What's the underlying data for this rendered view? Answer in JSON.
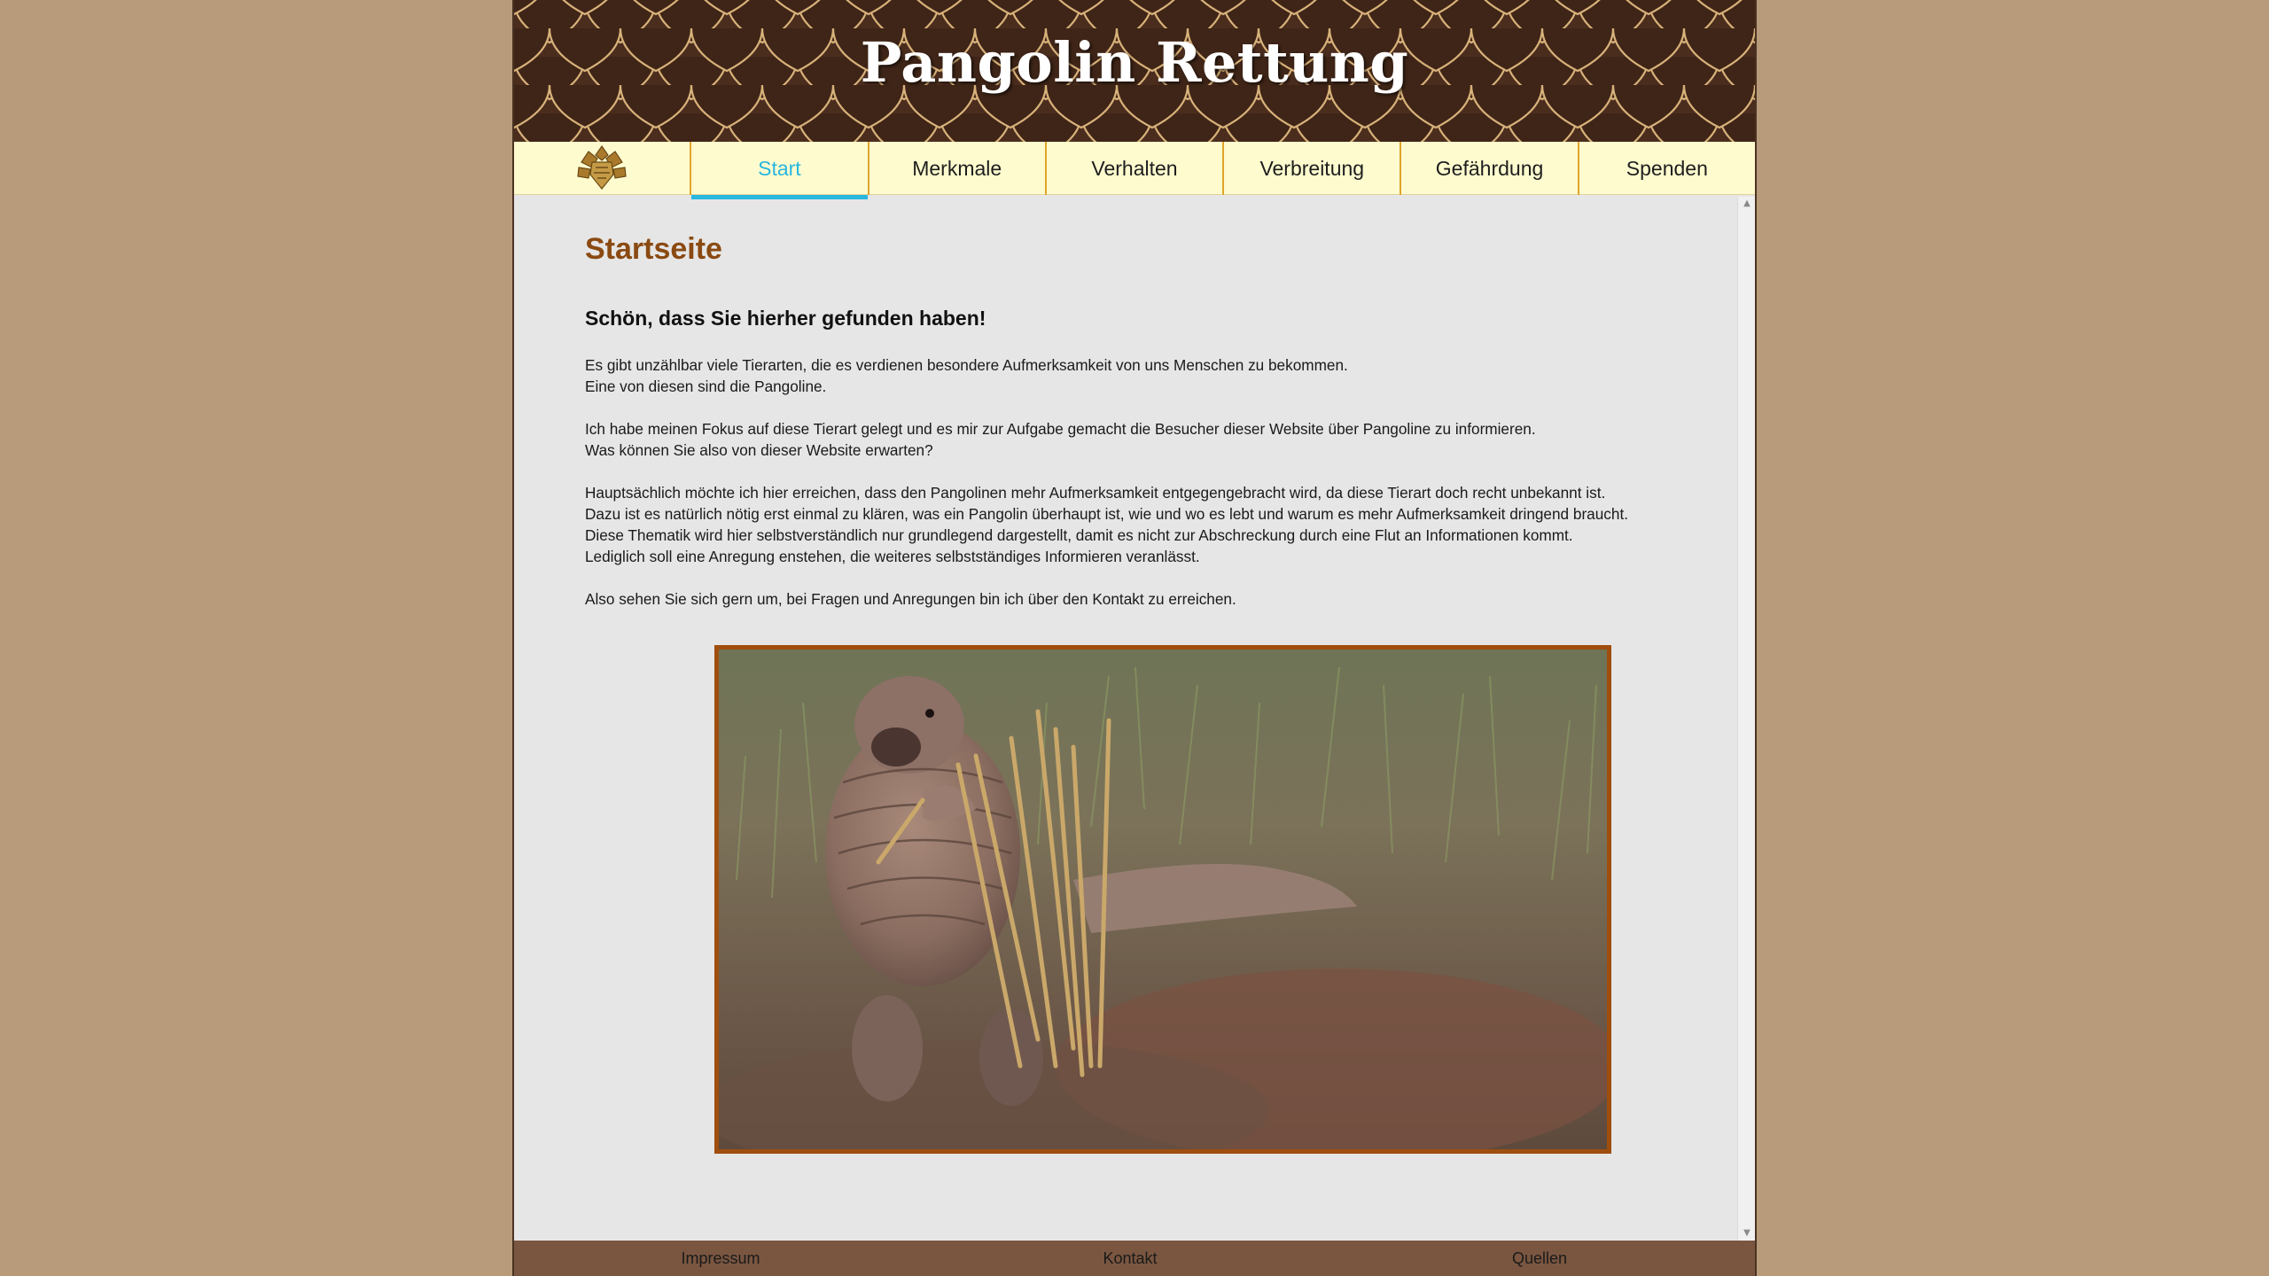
{
  "header": {
    "title": "Pangolin Rettung"
  },
  "nav": {
    "items": [
      {
        "label": "Start",
        "active": true
      },
      {
        "label": "Merkmale",
        "active": false
      },
      {
        "label": "Verhalten",
        "active": false
      },
      {
        "label": "Verbreitung",
        "active": false
      },
      {
        "label": "Gefährdung",
        "active": false
      },
      {
        "label": "Spenden",
        "active": false
      }
    ],
    "logo_icon": "pangolin-emblem-icon"
  },
  "main": {
    "heading": "Startseite",
    "welcome": "Schön, dass Sie hierher gefunden haben!",
    "paragraphs": [
      [
        "Es gibt unzählbar viele Tierarten, die es verdienen besondere Aufmerksamkeit von uns Menschen zu bekommen.",
        "Eine von diesen sind die Pangoline."
      ],
      [
        "Ich habe meinen Fokus auf diese Tierart gelegt und es mir zur Aufgabe gemacht die Besucher dieser Website über Pangoline zu informieren.",
        "Was können Sie also von dieser Website erwarten?"
      ],
      [
        "Hauptsächlich möchte ich hier erreichen, dass den Pangolinen mehr Aufmerksamkeit entgegengebracht wird, da diese Tierart doch recht unbekannt ist.",
        "Dazu ist es natürlich nötig erst einmal zu klären, was ein Pangolin überhaupt ist, wie und wo es lebt und warum es mehr Aufmerksamkeit dringend braucht.",
        "Diese Thematik wird hier selbstverständlich nur grundlegend dargestellt, damit es nicht zur Abschreckung durch eine Flut an Informationen kommt.",
        "Lediglich soll eine Anregung enstehen, die weiteres selbstständiges Informieren veranlässt."
      ],
      [
        "Also sehen Sie sich gern um, bei Fragen und Anregungen bin ich über den Kontakt zu erreichen."
      ]
    ]
  },
  "footer": {
    "links": [
      "Impressum",
      "Kontakt",
      "Quellen"
    ]
  },
  "colors": {
    "page_bg": "#b89b7a",
    "header_bg": "#4b2d1e",
    "scale_line": "#d8b27a",
    "nav_bg": "#fefccf",
    "nav_divider": "#e0a52a",
    "active_accent": "#29b6df",
    "heading": "#8a4a12",
    "photo_border": "#a04e0e",
    "footer_bg": "#7a5640"
  }
}
